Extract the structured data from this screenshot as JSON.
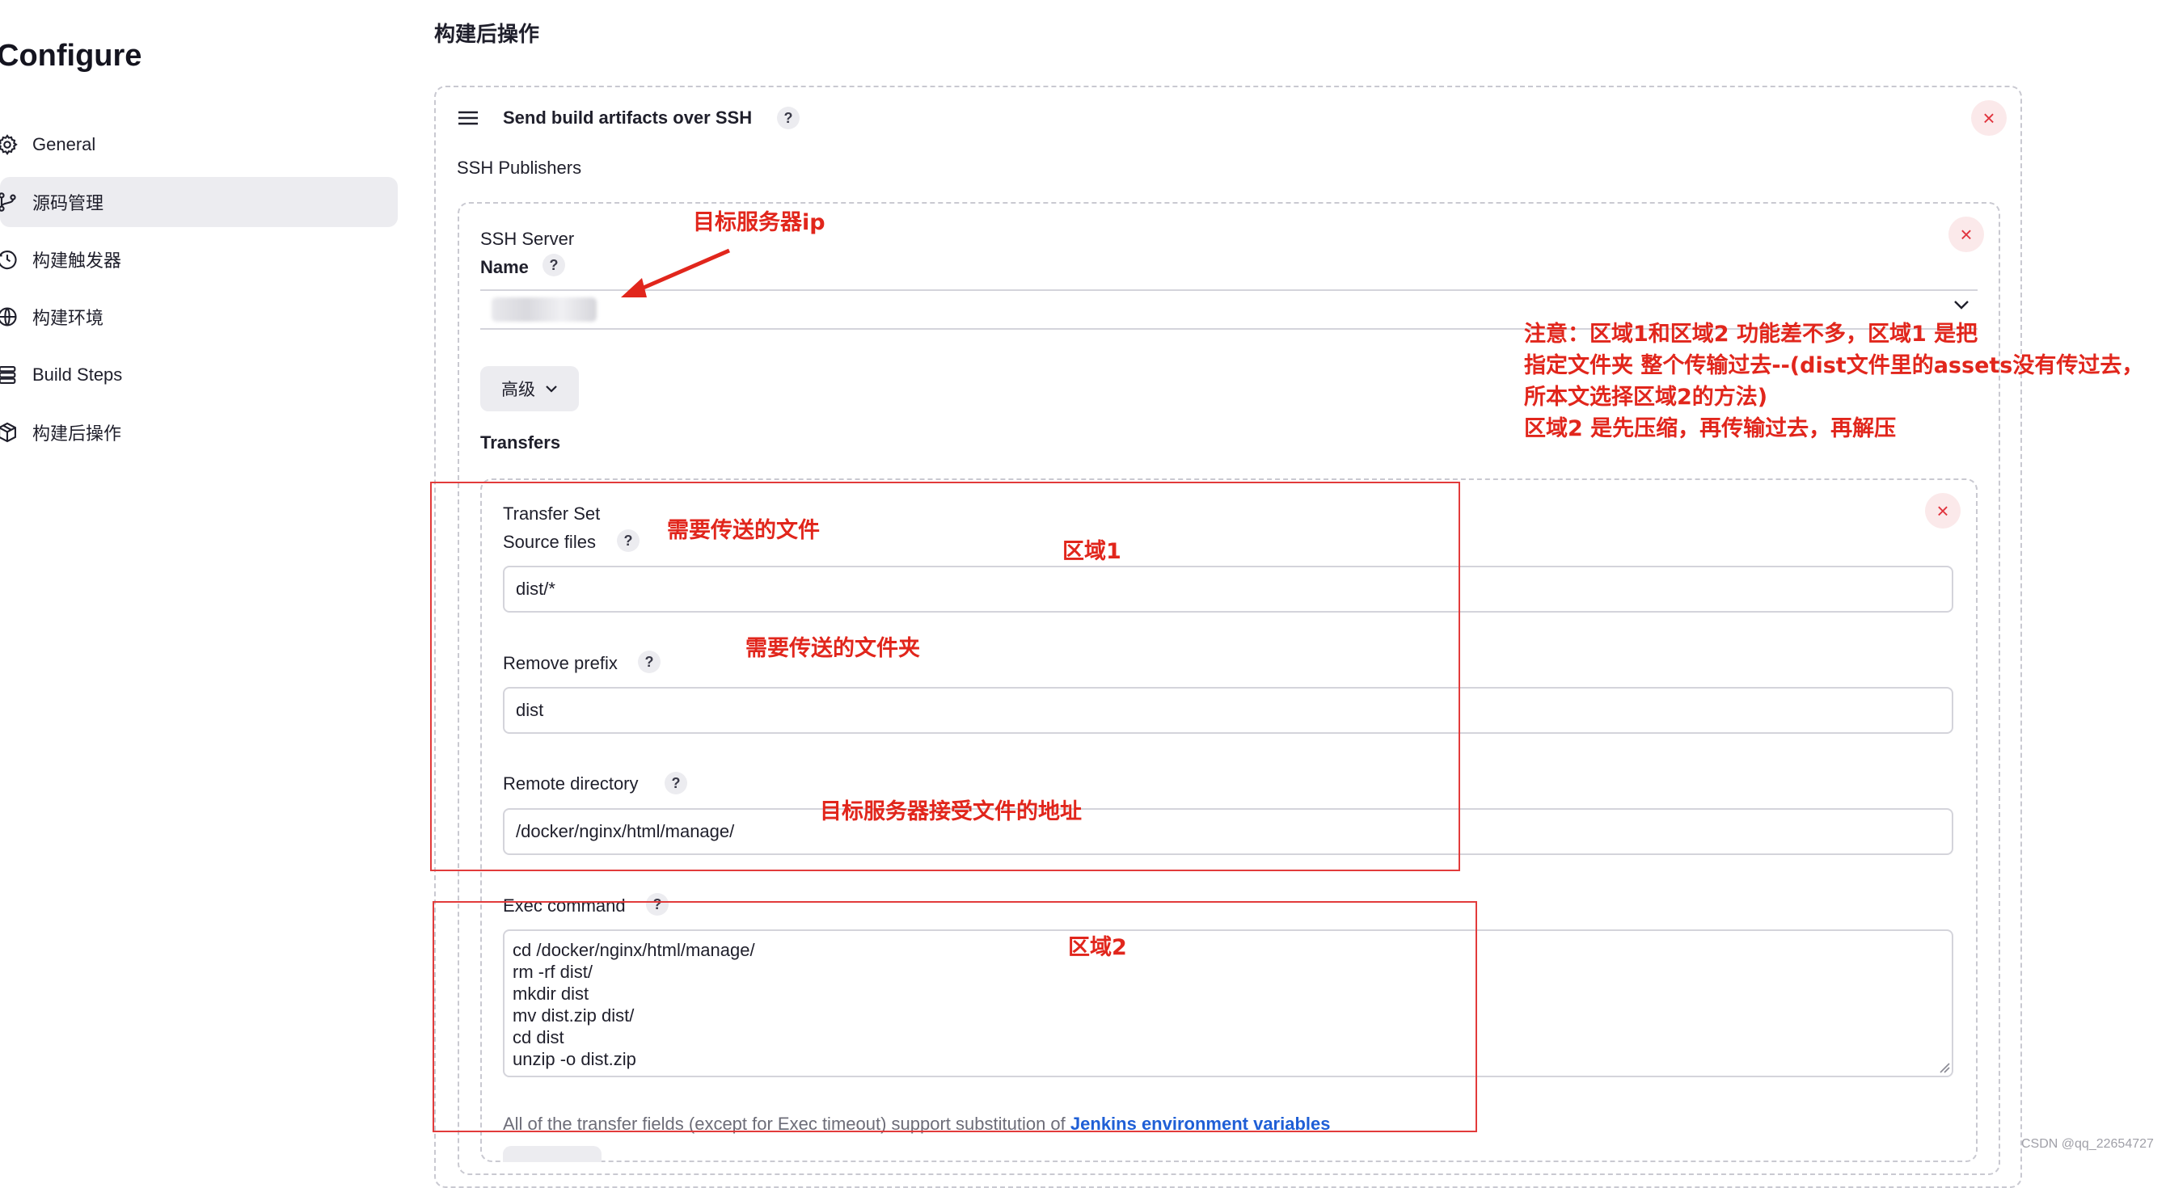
{
  "sidebar": {
    "title": "Configure",
    "items": [
      {
        "label": "General",
        "icon": "gear-icon",
        "active": false
      },
      {
        "label": "源码管理",
        "icon": "source-branch-icon",
        "active": true
      },
      {
        "label": "构建触发器",
        "icon": "clock-icon",
        "active": false
      },
      {
        "label": "构建环境",
        "icon": "globe-icon",
        "active": false
      },
      {
        "label": "Build Steps",
        "icon": "list-icon",
        "active": false
      },
      {
        "label": "构建后操作",
        "icon": "package-icon",
        "active": false
      }
    ]
  },
  "main": {
    "section_title": "构建后操作",
    "publisher": {
      "title": "Send build artifacts over SSH",
      "subtitle": "SSH Publishers",
      "server": {
        "heading": "SSH Server",
        "name_label": "Name",
        "advanced_label": "高级",
        "transfers_label": "Transfers",
        "transfer_set": {
          "heading": "Transfer Set",
          "source_files_label": "Source files",
          "source_files_value": "dist/*",
          "remove_prefix_label": "Remove prefix",
          "remove_prefix_value": "dist",
          "remote_directory_label": "Remote directory",
          "remote_directory_value": "/docker/nginx/html/manage/",
          "exec_command_label": "Exec command",
          "exec_command_value": "cd /docker/nginx/html/manage/\nrm -rf dist/\nmkdir dist\nmv dist.zip dist/\ncd dist\nunzip -o dist.zip",
          "footer_text": "All of the transfer fields (except for Exec timeout) support substitution of",
          "footer_link": "Jenkins environment variables"
        }
      }
    }
  },
  "annotations": {
    "target_ip": "目标服务器ip",
    "note_lines": [
      "注意：区域1和区域2 功能差不多，区域1 是把",
      "指定文件夹 整个传输过去--(dist文件里的assets没有传过去，",
      "所本文选择区域2的方法)",
      "区域2 是先压缩，再传输过去，再解压"
    ],
    "source_files_note": "需要传送的文件",
    "region1": "区域1",
    "remove_prefix_note": "需要传送的文件夹",
    "remote_dir_note": "目标服务器接受文件的地址",
    "region2": "区域2",
    "color": "#e1261c"
  },
  "watermark": "CSDN @qq_22654727"
}
